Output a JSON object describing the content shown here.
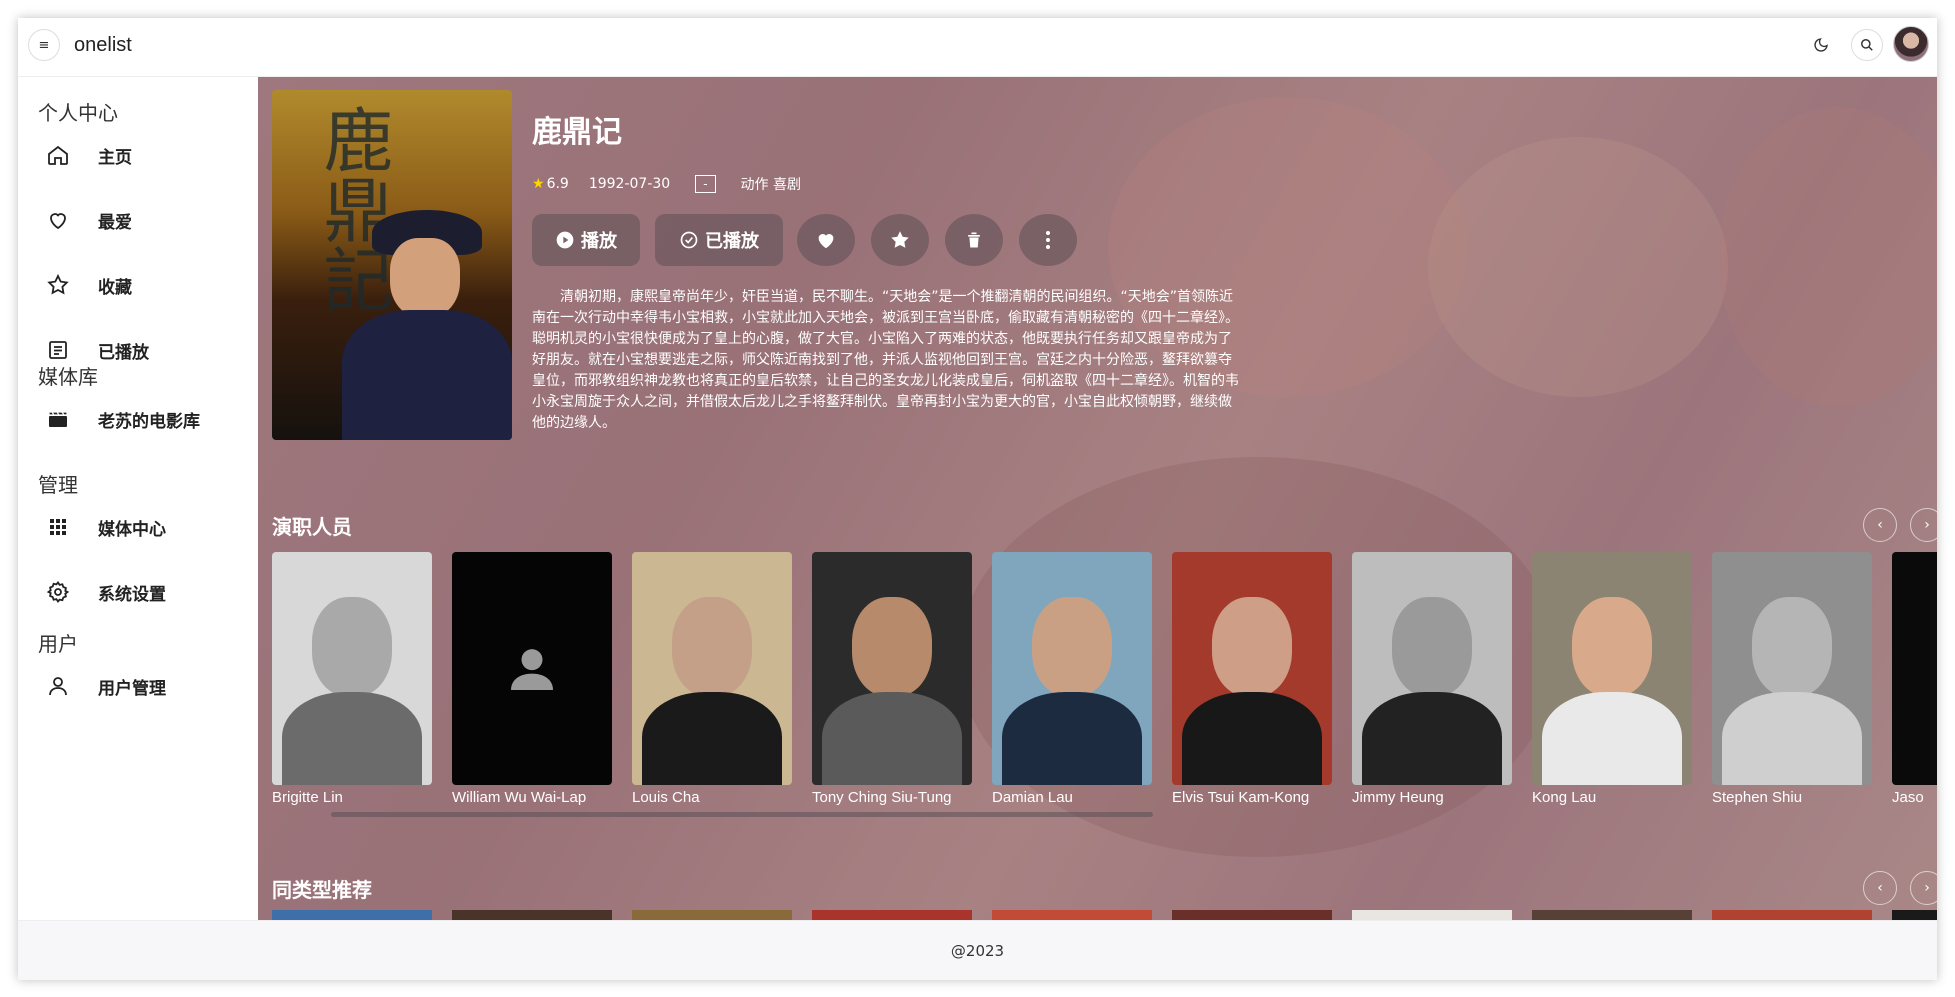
{
  "app": {
    "title": "onelist",
    "menu_icon": "≡"
  },
  "topbar": {
    "icons": [
      "moon-icon",
      "search-icon",
      "user-avatar"
    ]
  },
  "sidebar": {
    "sections": [
      {
        "title": "个人中心",
        "items": [
          {
            "label": "主页",
            "icon": "home-icon"
          },
          {
            "label": "最爱",
            "icon": "heart-icon"
          },
          {
            "label": "收藏",
            "icon": "star-icon"
          },
          {
            "label": "已播放",
            "icon": "list-icon"
          }
        ]
      },
      {
        "title": "媒体库",
        "items": [
          {
            "label": "老苏的电影库",
            "icon": "clapperboard-icon"
          }
        ]
      },
      {
        "title": "管理",
        "items": [
          {
            "label": "媒体中心",
            "icon": "grid-icon"
          },
          {
            "label": "系统设置",
            "icon": "gear-icon"
          }
        ]
      },
      {
        "title": "用户",
        "items": [
          {
            "label": "用户管理",
            "icon": "user-icon"
          }
        ]
      }
    ]
  },
  "movie": {
    "title": "鹿鼎记",
    "rating": "6.9",
    "date": "1992-07-30",
    "box": "-",
    "genres": "动作 喜剧",
    "buttons": {
      "play": "播放",
      "played": "已播放"
    },
    "synopsis": "清朝初期，康熙皇帝尚年少，奸臣当道，民不聊生。“天地会”是一个推翻清朝的民间组织。“天地会”首领陈近南在一次行动中幸得韦小宝相救，小宝就此加入天地会，被派到王宫当卧底，偷取藏有清朝秘密的《四十二章经》。聪明机灵的小宝很快便成为了皇上的心腹，做了大官。小宝陷入了两难的状态，他既要执行任务却又跟皇帝成为了好朋友。就在小宝想要逃走之际，师父陈近南找到了他，并派人监视他回到王宫。宫廷之内十分险恶，鳌拜欲篡夺皇位，而邪教组织神龙教也将真正的皇后软禁，让自己的圣女龙儿化装成皇后，伺机盗取《四十二章经》。机智的韦小永宝周旋于众人之间，并借假太后龙儿之手将鳌拜制伏。皇帝再封小宝为更大的官，小宝自此权倾朝野，继续做他的边缘人。",
    "poster_text": "鹿鼎記"
  },
  "cast": {
    "heading": "演职人员",
    "members": [
      {
        "name": "Brigitte Lin"
      },
      {
        "name": "William Wu Wai-Lap"
      },
      {
        "name": "Louis Cha"
      },
      {
        "name": "Tony Ching Siu-Tung"
      },
      {
        "name": "Damian Lau"
      },
      {
        "name": "Elvis Tsui Kam-Kong"
      },
      {
        "name": "Jimmy Heung"
      },
      {
        "name": "Kong Lau"
      },
      {
        "name": "Stephen Shiu"
      },
      {
        "name": "Jaso"
      }
    ]
  },
  "recommend": {
    "heading": "同类型推荐"
  },
  "footer": {
    "text": "@2023"
  },
  "colors": {
    "accent_overlay": "#9b7479",
    "star": "#ffd400",
    "footer_bg": "#f7f7f9"
  }
}
